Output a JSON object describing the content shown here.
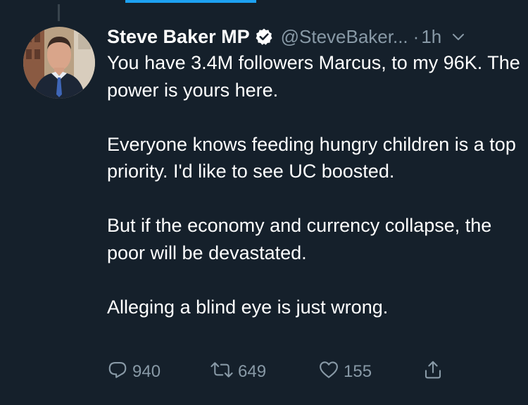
{
  "tweet": {
    "display_name": "Steve Baker MP",
    "handle": "@SteveBaker...",
    "separator": "·",
    "time": "1h",
    "paragraphs": [
      "You have 3.4M followers Marcus, to my 96K. The power is yours here.",
      "Everyone knows feeding hungry children is a top priority. I'd like to see UC boosted.",
      "But if the economy and currency collapse, the poor will be devastated.",
      "Alleging a blind eye is just wrong."
    ],
    "reply_count": "940",
    "retweet_count": "649",
    "like_count": "155"
  },
  "icons": {
    "verified": "verified-badge-icon",
    "chevron": "chevron-down-icon",
    "reply": "reply-icon",
    "retweet": "retweet-icon",
    "like": "heart-icon",
    "share": "share-icon"
  },
  "colors": {
    "background": "#15202b",
    "primary_text": "#ffffff",
    "secondary_text": "#8899a6",
    "accent": "#1da1f2"
  }
}
